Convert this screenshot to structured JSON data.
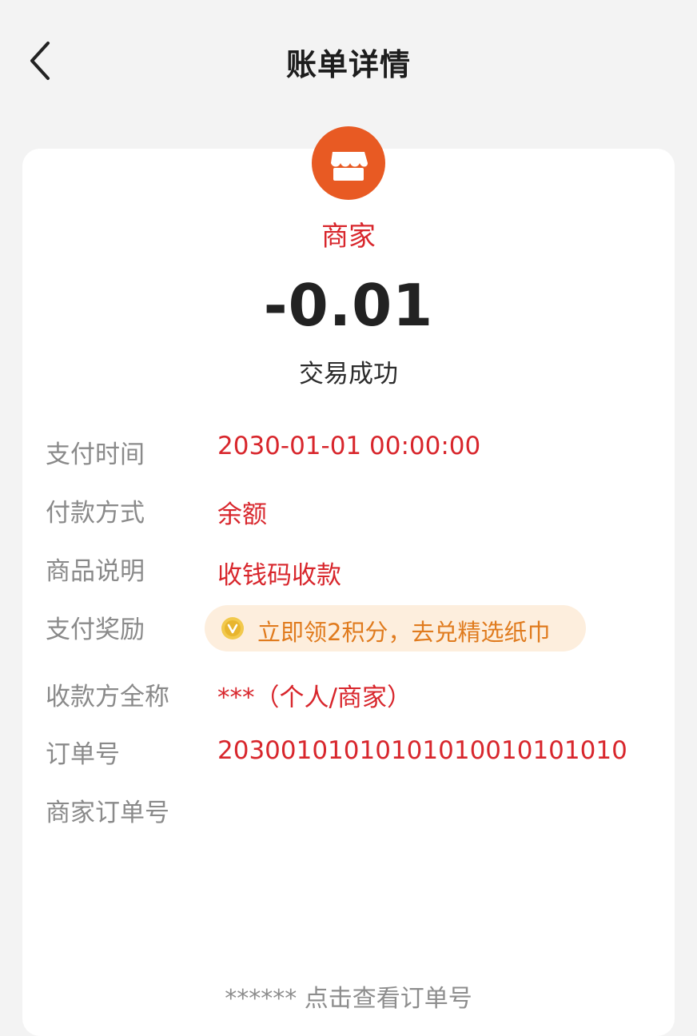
{
  "header": {
    "title": "账单详情",
    "back_icon": "chevron-left-icon"
  },
  "merchant": {
    "icon": "store-icon",
    "icon_color": "#e85a23",
    "name": "商家"
  },
  "amount": "-0.01",
  "status": "交易成功",
  "details": {
    "pay_time": {
      "label": "支付时间",
      "value": "2030-01-01 00:00:00"
    },
    "pay_method": {
      "label": "付款方式",
      "value": "余额"
    },
    "goods_desc": {
      "label": "商品说明",
      "value": "收钱码收款"
    },
    "pay_reward": {
      "label": "支付奖励",
      "value": "立即领2积分，去兑精选纸巾",
      "icon": "coin-icon"
    },
    "payee_name": {
      "label": "收款方全称",
      "value": "***（个人/商家）"
    },
    "order_no": {
      "label": "订单号",
      "value": "20300101010101010010101010"
    },
    "merchant_order_no": {
      "label": "商家订单号"
    }
  },
  "footer": {
    "view_order": "****** 点击查看订单号"
  },
  "colors": {
    "accent_red": "#d8262c",
    "brand_orange": "#e85a23",
    "reward_text": "#e07b1e",
    "reward_bg": "#fdeedd"
  }
}
